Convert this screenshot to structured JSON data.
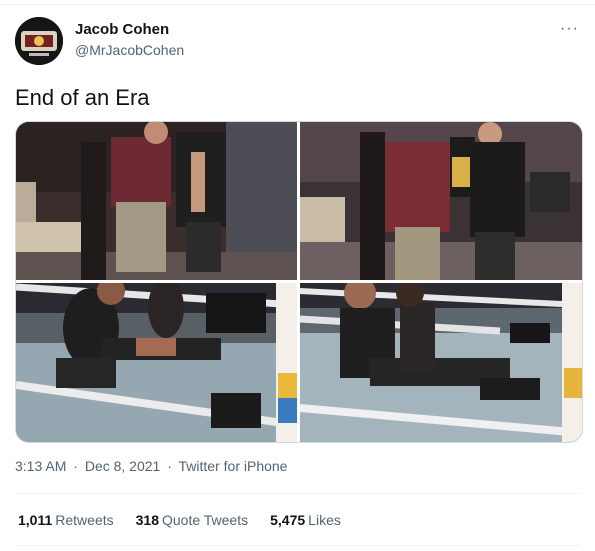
{
  "author": {
    "display_name": "Jacob Cohen",
    "handle": "@MrJacobCohen",
    "avatar_icon": "avatar-image"
  },
  "more_icon": "···",
  "tweet_text": "End of an Era",
  "photos": [
    {
      "alt": "photo-1"
    },
    {
      "alt": "photo-2"
    },
    {
      "alt": "photo-3"
    },
    {
      "alt": "photo-4"
    }
  ],
  "meta": {
    "time": "3:13 AM",
    "sep1": "·",
    "date": "Dec 8, 2021",
    "sep2": "·",
    "source": "Twitter for iPhone"
  },
  "stats": {
    "retweets_count": "1,011",
    "retweets_label": "Retweets",
    "quotes_count": "318",
    "quotes_label": "Quote Tweets",
    "likes_count": "5,475",
    "likes_label": "Likes"
  },
  "colors": {
    "secondary_text": "#536471",
    "primary_text": "#0f1419",
    "border": "#cfd9de"
  }
}
